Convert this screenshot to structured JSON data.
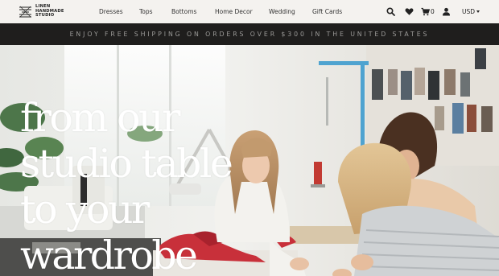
{
  "header": {
    "logo": {
      "line1": "LINEN",
      "line2": "HANDMADE",
      "line3": "STUDIO"
    },
    "nav": [
      "Dresses",
      "Tops",
      "Bottoms",
      "Home Decor",
      "Wedding",
      "Gift Cards"
    ],
    "icons": [
      "search-icon",
      "heart-icon",
      "cart-icon",
      "user-icon"
    ],
    "cart_count": "0",
    "currency": "USD"
  },
  "announcement": "ENJOY FREE SHIPPING ON ORDERS OVER $300 IN THE UNITED STATES",
  "hero": {
    "headline": [
      "from our",
      "studio table",
      "to your",
      "wardrobe"
    ]
  },
  "colors": {
    "header_bg": "#f4f2ef",
    "announcement_bg": "#1f1e1d",
    "announcement_text": "#9b9a98",
    "headline": "#ffffff",
    "fabric_red": "#c8303a"
  }
}
